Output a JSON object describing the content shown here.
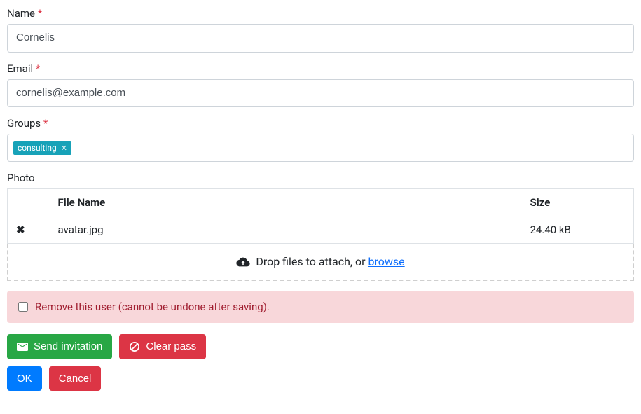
{
  "labels": {
    "name": "Name",
    "email": "Email",
    "groups": "Groups",
    "photo": "Photo"
  },
  "fields": {
    "name": "Cornelis",
    "email": "cornelis@example.com"
  },
  "groups": {
    "items": [
      {
        "label": "consulting"
      }
    ]
  },
  "file_table": {
    "headers": {
      "filename": "File Name",
      "size": "Size"
    },
    "rows": [
      {
        "filename": "avatar.jpg",
        "size": "24.40 kB"
      }
    ]
  },
  "dropzone": {
    "text_prefix": "Drop files to attach, or ",
    "link": "browse"
  },
  "remove_user": {
    "label": "Remove this user (cannot be undone after saving)."
  },
  "buttons": {
    "send_invitation": "Send invitation",
    "clear_pass": "Clear pass",
    "ok": "OK",
    "cancel": "Cancel"
  },
  "required_marker": "*"
}
